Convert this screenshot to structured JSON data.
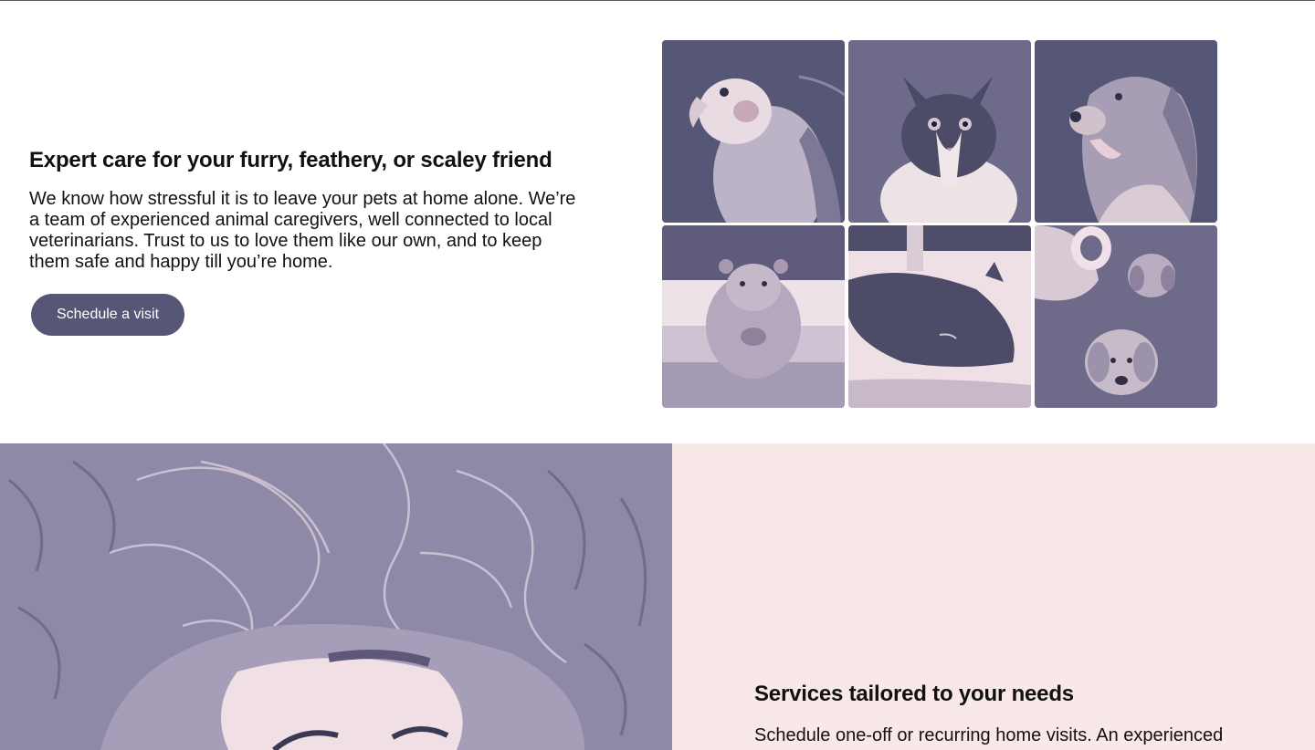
{
  "hero": {
    "title": "Expert care for your furry, feathery, or scaley friend",
    "body": "We know how stressful it is to leave your pets at home alone. We’re a team of experienced animal caregivers, well connected to local veterinarians. Trust to us to love them like our own, and to keep them safe and happy till you’re home.",
    "cta_label": "Schedule a visit"
  },
  "gallery": {
    "photos": [
      "cockatiel",
      "cat",
      "golden-retriever",
      "hamster",
      "sleeping-cat",
      "two-puppies"
    ]
  },
  "services": {
    "title": "Services tailored to your needs",
    "body": "Schedule one-off or recurring home visits. An experienced"
  },
  "colors": {
    "accent": "#565676",
    "duotone_dark": "#565676",
    "duotone_light": "#f8e9e8",
    "services_bg": "#f8e9e8"
  }
}
